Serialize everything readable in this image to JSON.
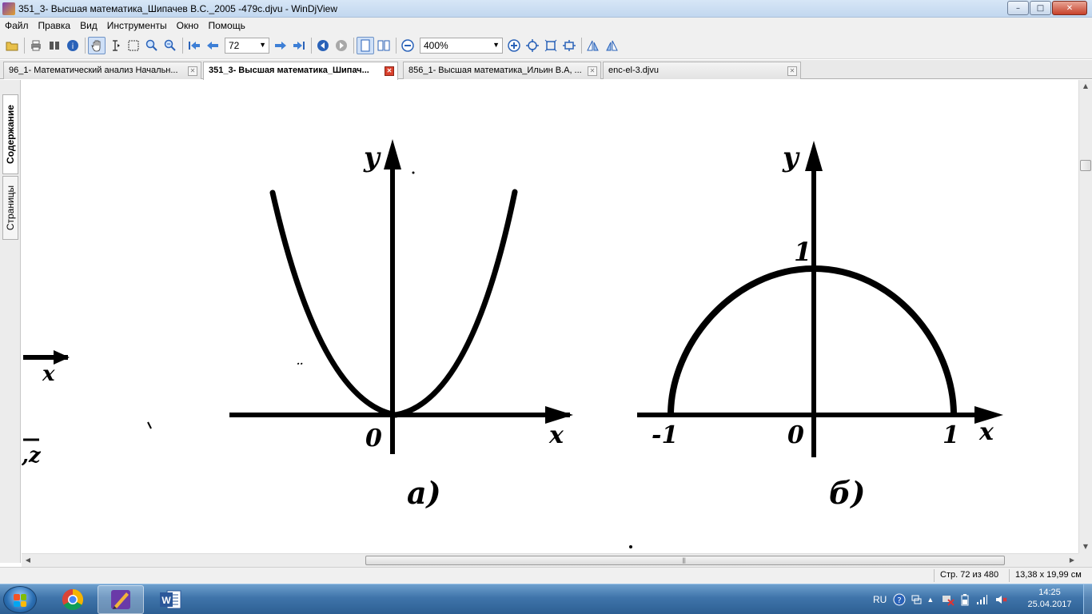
{
  "window": {
    "title": "351_3- Высшая математика_Шипачев В.С._2005 -479c.djvu - WinDjView",
    "minimize_glyph": "–",
    "maximize_glyph": "□",
    "close_glyph": "✕"
  },
  "menu": {
    "items": [
      "Файл",
      "Правка",
      "Вид",
      "Инструменты",
      "Окно",
      "Помощь"
    ]
  },
  "toolbar": {
    "page_number": "72",
    "zoom": "400%",
    "icons": [
      "open-icon",
      "print-icon",
      "find-icon",
      "info-icon",
      "hand-icon",
      "text-select-icon",
      "rect-select-icon",
      "zoom-in-tool-icon",
      "zoom-rect-icon",
      "first-page-icon",
      "prev-page-icon",
      "next-page-icon",
      "last-page-icon",
      "back-icon",
      "forward-icon",
      "single-page-icon",
      "facing-pages-icon",
      "zoom-out-icon",
      "zoom-in-icon",
      "fit-page-icon",
      "fit-width-icon",
      "actual-size-icon",
      "rotate-left-icon",
      "rotate-right-icon"
    ]
  },
  "tabs": [
    {
      "label": "96_1- Математический анализ Начальн...",
      "active": false
    },
    {
      "label": "351_3- Высшая математика_Шипач...",
      "active": true
    },
    {
      "label": "856_1- Высшая математика_Ильин В.А, ...",
      "active": false
    },
    {
      "label": "enc-el-3.djvu",
      "active": false
    }
  ],
  "sidebar": {
    "tabs": [
      {
        "label": "Содержание",
        "active": true
      },
      {
        "label": "Страницы",
        "active": false
      }
    ]
  },
  "document": {
    "left_fragment": {
      "axis_label": "x",
      "symbol": ",z"
    },
    "figure_a": {
      "y_label": "y",
      "x_label": "x",
      "origin_label": "0",
      "caption": "а)"
    },
    "figure_b": {
      "y_label": "y",
      "x_label": "x",
      "origin_label": "0",
      "y_tick": "1",
      "x_tick_neg": "-1",
      "x_tick_pos": "1",
      "caption": "б)"
    }
  },
  "status": {
    "page_info": "Стр. 72 из 480",
    "page_size": "13,38 x 19,99 см"
  },
  "taskbar": {
    "language": "RU",
    "time": "14:25",
    "date": "25.04.2017",
    "apps": [
      "chrome-icon",
      "windjview-icon",
      "word-icon"
    ]
  }
}
